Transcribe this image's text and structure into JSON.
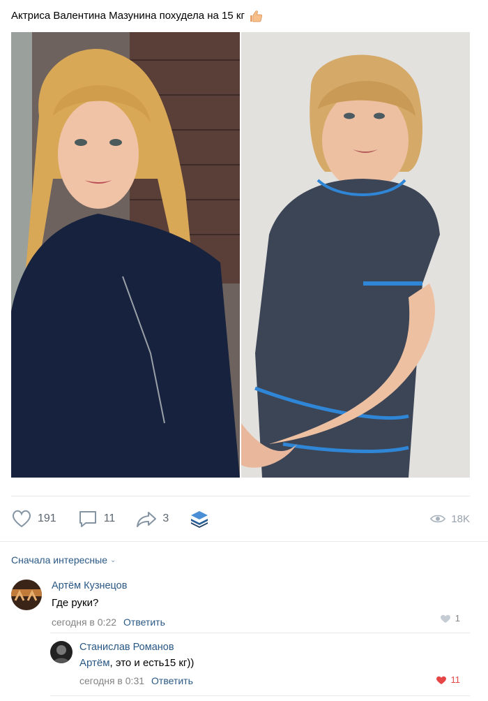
{
  "post": {
    "title": "Актриса Валентина Мазунина похудела на 15 кг",
    "emoji": "thumbs-up-icon"
  },
  "actions": {
    "likes": "191",
    "comments": "11",
    "shares": "3",
    "views": "18K"
  },
  "sort": {
    "label": "Сначала интересные"
  },
  "comments": [
    {
      "author": "Артём Кузнецов",
      "text": "Где руки?",
      "time": "сегодня в 0:22",
      "reply_label": "Ответить",
      "likes": "1",
      "liked": false
    },
    {
      "author": "Станислав Романов",
      "reply_to": "Артём",
      "text": ", это и есть15 кг))",
      "time": "сегодня в 0:31",
      "reply_label": "Ответить",
      "likes": "11",
      "liked": true
    }
  ],
  "colors": {
    "link": "#2a5885",
    "muted": "#828282",
    "like_active": "#e64646",
    "divider": "#e7e8ec"
  }
}
